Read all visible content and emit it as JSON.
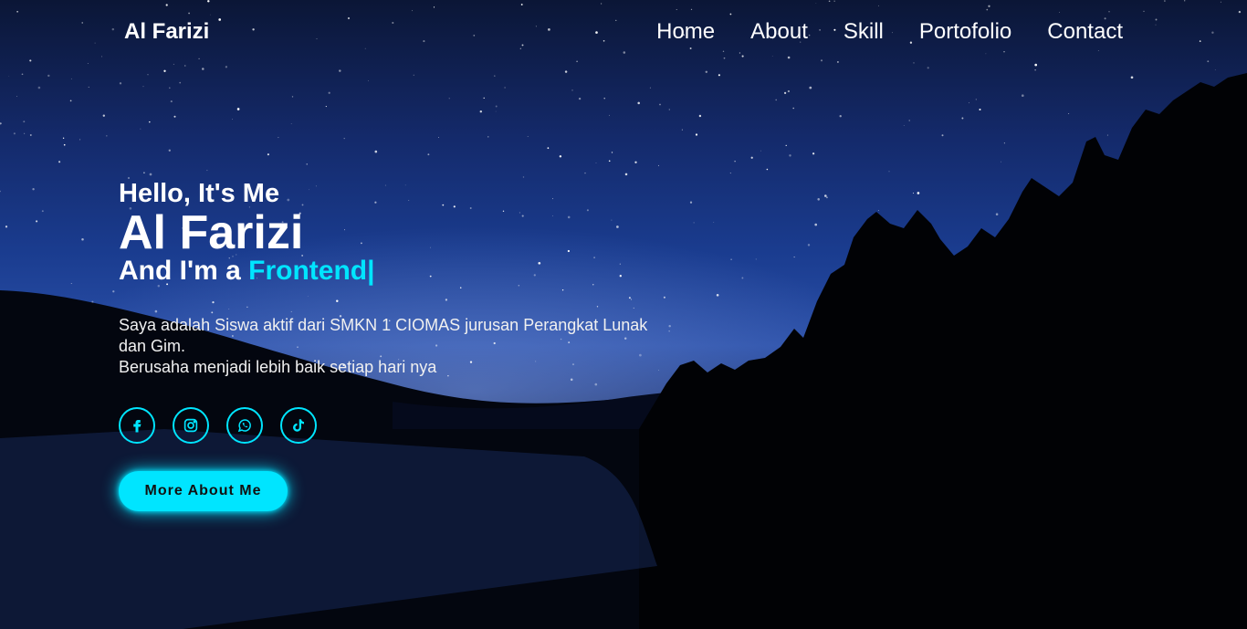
{
  "header": {
    "logo": "Al Farizi",
    "nav": [
      {
        "label": "Home"
      },
      {
        "label": "About"
      },
      {
        "label": "Skill"
      },
      {
        "label": "Portofolio"
      },
      {
        "label": "Contact"
      }
    ]
  },
  "hero": {
    "greeting": "Hello, It's Me",
    "name": "Al Farizi",
    "role_prefix": "And I'm a ",
    "role_typed": "Frontend|",
    "description_line1": "Saya adalah Siswa aktif dari SMKN 1 CIOMAS jurusan Perangkat Lunak dan Gim.",
    "description_line2": "Berusaha menjadi lebih baik setiap hari nya",
    "socials": [
      {
        "icon": "facebook-icon"
      },
      {
        "icon": "instagram-icon"
      },
      {
        "icon": "whatsapp-icon"
      },
      {
        "icon": "tiktok-icon"
      }
    ],
    "cta": "More About Me"
  },
  "colors": {
    "accent": "#00e5ff",
    "text": "#ffffff"
  }
}
